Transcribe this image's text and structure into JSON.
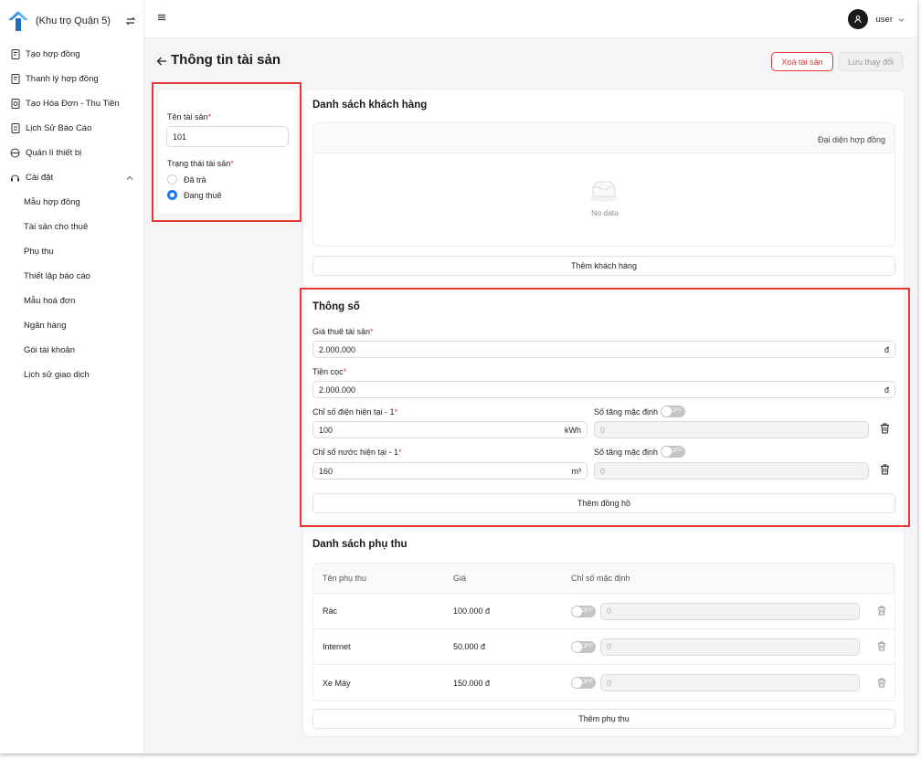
{
  "brand": {
    "name": "(Khu trọ Quận 5)"
  },
  "sidebar": {
    "items": [
      {
        "label": "Tạo hợp đồng",
        "icon": "contract-icon"
      },
      {
        "label": "Thanh lý hợp đồng",
        "icon": "contract-icon"
      },
      {
        "label": "Tạo Hóa Đơn - Thu Tiền",
        "icon": "invoice-icon"
      },
      {
        "label": "Lịch Sử Báo Cáo",
        "icon": "report-icon"
      },
      {
        "label": "Quản lí thiết bị",
        "icon": "device-icon"
      },
      {
        "label": "Cài đặt",
        "icon": "settings-icon"
      }
    ],
    "settings_subitems": [
      "Mẫu hợp đồng",
      "Tài sản cho thuê",
      "Phụ thu",
      "Thiết lập báo cáo",
      "Mẫu hoá đơn",
      "Ngân hàng",
      "Gói tài khoản",
      "Lịch sử giao dịch"
    ]
  },
  "header": {
    "user": "user"
  },
  "page": {
    "title": "Thông tin tài sản",
    "delete_label": "Xoá tài sản",
    "save_label": "Lưu thay đổi"
  },
  "asset": {
    "name_label": "Tên tài sản",
    "name_value": "101",
    "status_label": "Trạng thái tài sản",
    "status_options": [
      "Đã trả",
      "Đang thuê"
    ],
    "status_selected": "Đang thuê"
  },
  "customers": {
    "title": "Danh sách khách hàng",
    "column": "Đại diện hợp đồng",
    "empty": "No data",
    "add_label": "Thêm khách hàng"
  },
  "params": {
    "title": "Thông số",
    "rent_label": "Giá thuê tài sản",
    "rent_value": "2.000.000",
    "rent_suffix": "đ",
    "deposit_label": "Tiền cọc",
    "deposit_value": "2.000.000",
    "deposit_suffix": "đ",
    "electric_label": "Chỉ số điện hiện tại - 1",
    "electric_value": "100",
    "electric_unit": "kWh",
    "electric_default_label": "Số tăng mặc định",
    "electric_default_value": "0",
    "water_label": "Chỉ số nước hiện tại - 1",
    "water_value": "160",
    "water_unit": "m³",
    "water_default_label": "Số tăng mặc định",
    "water_default_value": "0",
    "toggle_text": "OFF",
    "add_meter_label": "Thêm đồng hồ"
  },
  "surcharges": {
    "title": "Danh sách phụ thu",
    "headers": [
      "Tên phụ thu",
      "Giá",
      "Chỉ số mặc định"
    ],
    "rows": [
      {
        "name": "Rác",
        "price": "100.000 đ",
        "toggle": "OFF",
        "value": "0"
      },
      {
        "name": "Internet",
        "price": "50.000 đ",
        "toggle": "OFF",
        "value": "0"
      },
      {
        "name": "Xe Máy",
        "price": "150.000 đ",
        "toggle": "OFF",
        "value": "0"
      }
    ],
    "add_label": "Thêm phụ thu"
  },
  "colors": {
    "accent": "#1677ff",
    "danger": "#e53935"
  }
}
